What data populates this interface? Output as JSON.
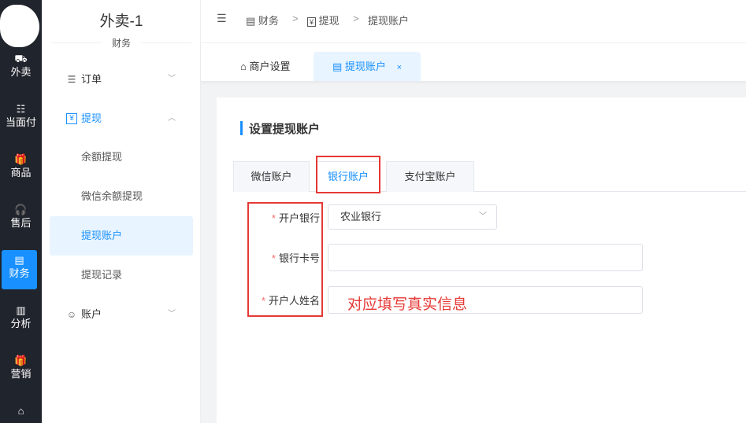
{
  "rail": {
    "items": [
      {
        "label": "外卖",
        "icon": "scooter-icon",
        "glyph": "⛟"
      },
      {
        "label": "当面付",
        "icon": "list-icon",
        "glyph": "☷"
      },
      {
        "label": "商品",
        "icon": "gift-icon",
        "glyph": "🎁"
      },
      {
        "label": "售后",
        "icon": "headset-icon",
        "glyph": "🎧"
      },
      {
        "label": "财务",
        "icon": "copy-icon",
        "glyph": "▤"
      },
      {
        "label": "分析",
        "icon": "bar-chart-icon",
        "glyph": "▥"
      },
      {
        "label": "营销",
        "icon": "gift-icon",
        "glyph": "🎁"
      },
      {
        "label": "",
        "icon": "store-icon",
        "glyph": "⌂"
      }
    ]
  },
  "submenu": {
    "title": "外卖-1",
    "subtitle": "财务",
    "groups": [
      {
        "label": "订单",
        "icon": "list-icon",
        "glyph": "☰",
        "chevron": "﹀"
      },
      {
        "label": "提现",
        "icon": "yen-icon",
        "glyph": "¥",
        "chevron": "︿"
      },
      {
        "label": "账户",
        "icon": "user-circle-icon",
        "glyph": "☺",
        "chevron": "﹀"
      }
    ],
    "subitems": [
      "余额提现",
      "微信余额提现",
      "提现账户",
      "提现记录"
    ]
  },
  "breadcrumb": {
    "collapse_glyph": "☰",
    "items": [
      {
        "label": "财务",
        "glyph": "▤"
      },
      {
        "label": "提现",
        "glyph": "¥"
      },
      {
        "label": "提现账户",
        "glyph": ""
      }
    ],
    "sep": ">"
  },
  "page_tabs": [
    {
      "label": "商户设置",
      "glyph": "⌂"
    },
    {
      "label": "提现账户",
      "glyph": "▤",
      "close": "×"
    }
  ],
  "section": {
    "title": "设置提现账户"
  },
  "inner_tabs": [
    "微信账户",
    "银行账户",
    "支付宝账户"
  ],
  "form": {
    "required_mark": "*",
    "bank": {
      "label": "开户银行",
      "value": "农业银行",
      "arrow": "﹀"
    },
    "card": {
      "label": "银行卡号",
      "value": ""
    },
    "name": {
      "label": "开户人姓名",
      "value": ""
    }
  },
  "annotation": "对应填写真实信息",
  "colors": {
    "primary": "#1890ff",
    "annotation_red": "#e53935",
    "rail_bg": "#20242c"
  }
}
